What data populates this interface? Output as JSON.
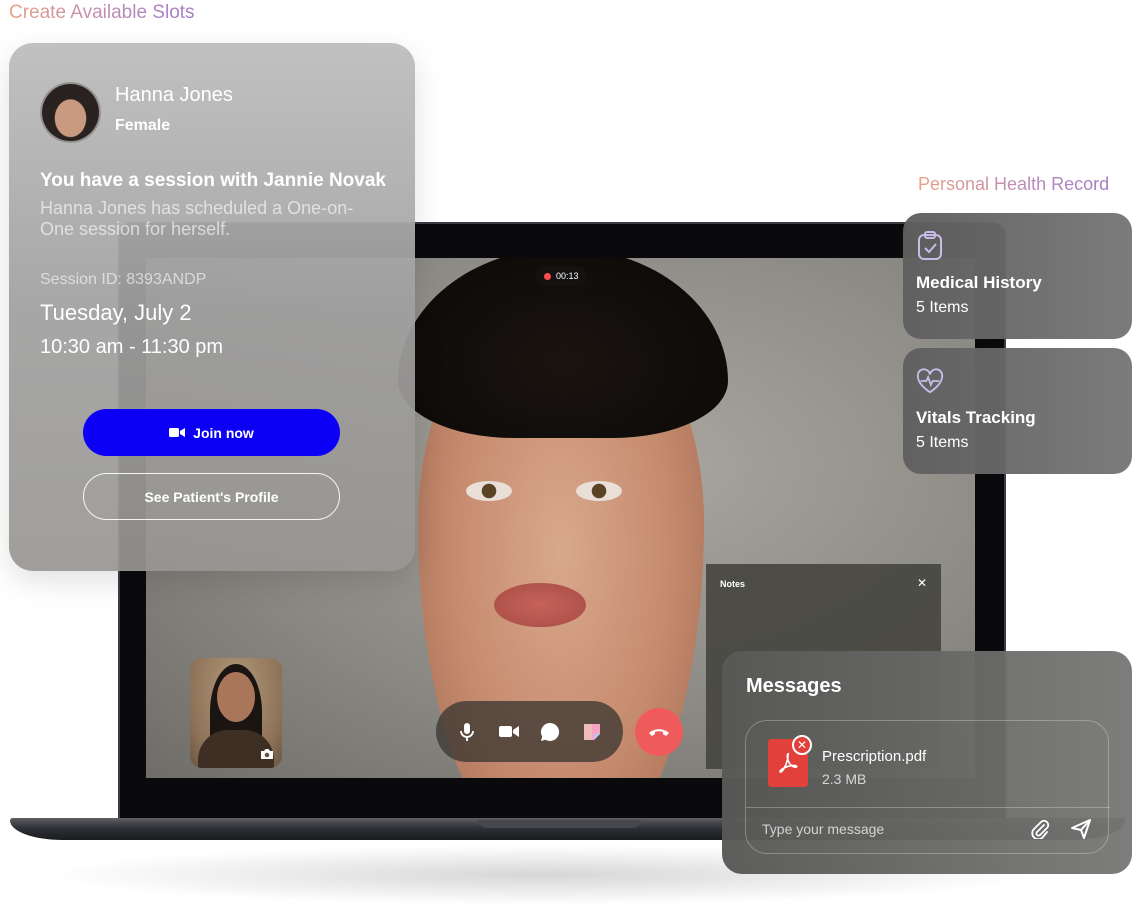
{
  "header": {
    "title": "Create Available Slots"
  },
  "session_card": {
    "patient_name": "Hanna Jones",
    "patient_gender": "Female",
    "heading": "You have a session with Jannie Novak",
    "description": "Hanna Jones has scheduled a One-on-One session for herself.",
    "session_id": "Session ID: 8393ANDP",
    "date": "Tuesday, July 2",
    "time": "10:30 am - 11:30 pm",
    "join_label": "Join now",
    "profile_label": "See Patient's Profile"
  },
  "call": {
    "timer": "00:13",
    "recording_color": "#ff4b4b",
    "end_call_color": "#ef5b5b",
    "controls": [
      "microphone-icon",
      "video-camera-icon",
      "chat-bubble-icon",
      "sticky-note-icon"
    ]
  },
  "notes": {
    "title": "Notes"
  },
  "health_record": {
    "title": "Personal Health Record",
    "items": [
      {
        "label": "Medical History",
        "count": "5 Items",
        "icon": "clipboard-check-icon"
      },
      {
        "label": "Vitals Tracking",
        "count": "5 Items",
        "icon": "heart-pulse-icon"
      }
    ]
  },
  "messages": {
    "title": "Messages",
    "attachment": {
      "name": "Prescription.pdf",
      "size": "2.3 MB",
      "icon": "pdf-file-icon"
    },
    "input_placeholder": "Type your message"
  },
  "colors": {
    "primary_button": "#0b00f5",
    "pdf_red": "#e2403a",
    "title_gradient": [
      "#e8a184",
      "#a27cc9"
    ]
  }
}
